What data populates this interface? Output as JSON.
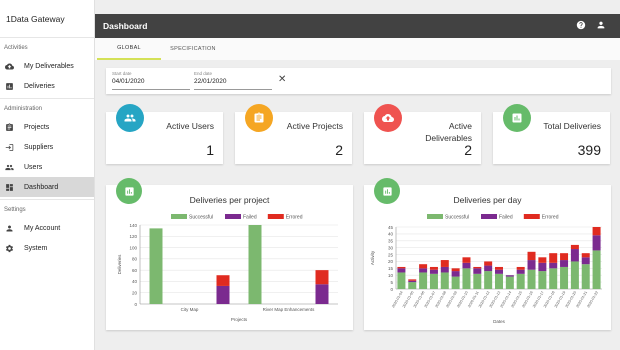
{
  "app": {
    "title": "1Data Gateway"
  },
  "sidebar": {
    "sections": [
      {
        "label": "Activities",
        "items": [
          {
            "label": "My Deliverables",
            "icon": "cloud-upload-icon"
          },
          {
            "label": "Deliveries",
            "icon": "bar-chart-icon"
          }
        ]
      },
      {
        "label": "Administration",
        "items": [
          {
            "label": "Projects",
            "icon": "clipboard-icon"
          },
          {
            "label": "Suppliers",
            "icon": "login-icon"
          },
          {
            "label": "Users",
            "icon": "people-icon"
          },
          {
            "label": "Dashboard",
            "icon": "dashboard-icon",
            "active": true
          }
        ]
      },
      {
        "label": "Settings",
        "items": [
          {
            "label": "My Account",
            "icon": "person-icon"
          },
          {
            "label": "System",
            "icon": "gear-icon"
          }
        ]
      }
    ]
  },
  "header": {
    "title": "Dashboard"
  },
  "tabs": [
    {
      "label": "GLOBAL",
      "active": true
    },
    {
      "label": "SPECIFICATION",
      "active": false
    }
  ],
  "filter": {
    "start": {
      "label": "Start date",
      "value": "04/01/2020"
    },
    "end": {
      "label": "End date",
      "value": "22/01/2020"
    },
    "clear_glyph": "✕"
  },
  "stats": [
    {
      "title": "Active Users",
      "value": "1",
      "color": "#26a5c4",
      "icon": "people-icon"
    },
    {
      "title": "Active Projects",
      "value": "2",
      "color": "#f5a623",
      "icon": "clipboard-icon"
    },
    {
      "title": "Active\nDeliverables",
      "value": "2",
      "color": "#ef5350",
      "icon": "cloud-upload-icon"
    },
    {
      "title": "Total Deliveries",
      "value": "399",
      "color": "#66bb6a",
      "icon": "bar-chart-icon"
    }
  ],
  "colors": {
    "successful": "#7cb86f",
    "failed": "#7b2a8f",
    "errored": "#e02b20",
    "accent": "#d4e157"
  },
  "chart_data": [
    {
      "type": "bar",
      "title": "Deliveries per project",
      "xlabel": "Projects",
      "ylabel": "Deliveries",
      "ylim": [
        0,
        140
      ],
      "yticks": [
        0,
        20,
        40,
        60,
        80,
        100,
        120,
        140
      ],
      "categories": [
        "City Map",
        "River Map Enhancements"
      ],
      "series": [
        {
          "name": "Successful",
          "values": [
            134,
            140
          ]
        },
        {
          "name": "Failed",
          "values": [
            0,
            0
          ]
        },
        {
          "name": "Errored",
          "values": [
            0,
            0
          ]
        },
        {
          "name": "Successful",
          "values": [
            0,
            0
          ]
        },
        {
          "name": "Failed",
          "values": [
            32,
            35
          ]
        },
        {
          "name": "Errored",
          "values": [
            19,
            25
          ]
        }
      ],
      "legend": [
        "Successful",
        "Failed",
        "Errored"
      ],
      "legend_position": "top",
      "grid": true
    },
    {
      "type": "bar",
      "title": "Deliveries per day",
      "xlabel": "Dates",
      "ylabel": "Activity",
      "ylim": [
        0,
        45
      ],
      "yticks": [
        0,
        5,
        10,
        15,
        20,
        25,
        30,
        35,
        40,
        45
      ],
      "categories": [
        "2020-01-04",
        "2020-01-05",
        "2020-01-06",
        "2020-01-07",
        "2020-01-08",
        "2020-01-09",
        "2020-01-10",
        "2020-01-11",
        "2020-01-12",
        "2020-01-13",
        "2020-01-14",
        "2020-01-15",
        "2020-01-16",
        "2020-01-17",
        "2020-01-18",
        "2020-01-19",
        "2020-01-20",
        "2020-01-21",
        "2020-01-22"
      ],
      "series": [
        {
          "name": "Successful",
          "values": [
            12,
            5,
            12,
            11,
            12,
            9,
            15,
            11,
            13,
            11,
            9,
            11,
            14,
            13,
            15,
            16,
            20,
            18,
            28
          ]
        },
        {
          "name": "Failed",
          "values": [
            3,
            1,
            3,
            3,
            4,
            4,
            4,
            4,
            4,
            3,
            1,
            3,
            7,
            6,
            4,
            5,
            9,
            5,
            11
          ]
        },
        {
          "name": "Errored",
          "values": [
            1,
            1,
            3,
            2,
            5,
            2,
            4,
            1,
            3,
            2,
            0,
            2,
            6,
            4,
            7,
            5,
            3,
            3,
            6
          ]
        }
      ],
      "legend": [
        "Successful",
        "Failed",
        "Errored"
      ],
      "legend_position": "top",
      "grid": true
    }
  ]
}
